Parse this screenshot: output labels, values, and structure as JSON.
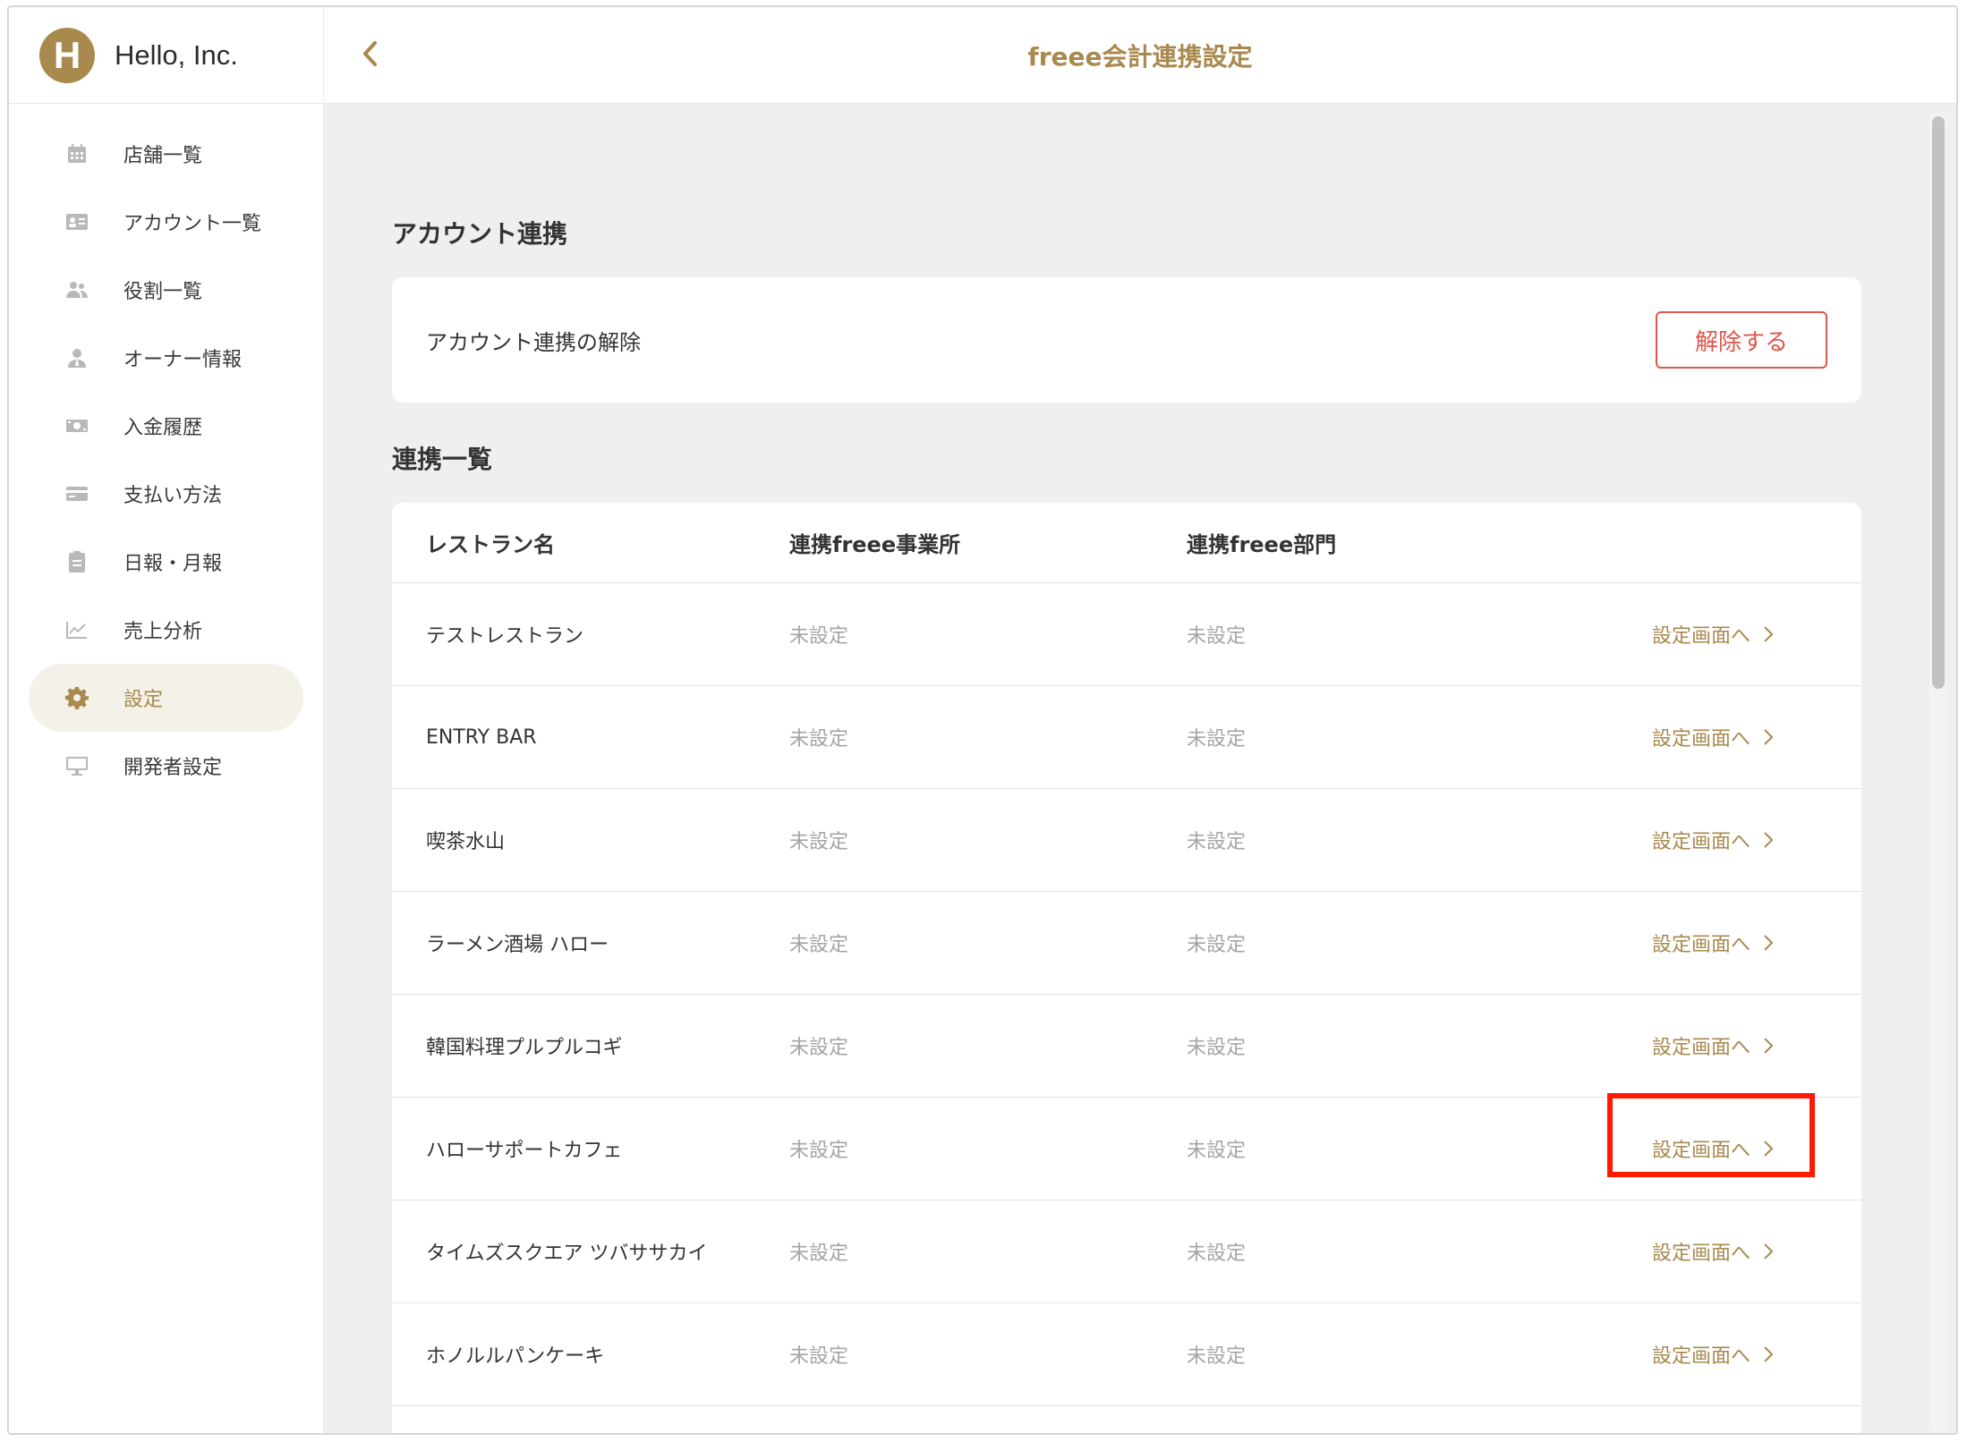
{
  "sidebar": {
    "brand_initial": "H",
    "brand_name": "Hello, Inc.",
    "items": [
      {
        "label": "店舗一覧",
        "icon": "calendar-icon",
        "active": false
      },
      {
        "label": "アカウント一覧",
        "icon": "id-card-icon",
        "active": false
      },
      {
        "label": "役割一覧",
        "icon": "users-icon",
        "active": false
      },
      {
        "label": "オーナー情報",
        "icon": "owner-icon",
        "active": false
      },
      {
        "label": "入金履歴",
        "icon": "money-icon",
        "active": false
      },
      {
        "label": "支払い方法",
        "icon": "credit-card-icon",
        "active": false
      },
      {
        "label": "日報・月報",
        "icon": "clipboard-icon",
        "active": false
      },
      {
        "label": "売上分析",
        "icon": "line-chart-icon",
        "active": false
      },
      {
        "label": "設定",
        "icon": "gear-icon",
        "active": true
      },
      {
        "label": "開発者設定",
        "icon": "monitor-icon",
        "active": false
      }
    ]
  },
  "header": {
    "title": "freee会計連携設定",
    "back_icon": "chevron-left-icon"
  },
  "account_section": {
    "title": "アカウント連携",
    "unlink_label": "アカウント連携の解除",
    "unlink_button": "解除する"
  },
  "list_section": {
    "title": "連携一覧",
    "columns": [
      "レストラン名",
      "連携freee事業所",
      "連携freee部門"
    ],
    "link_label": "設定画面へ",
    "rows": [
      {
        "name": "テストレストラン",
        "office": "未設定",
        "department": "未設定"
      },
      {
        "name": "ENTRY BAR",
        "office": "未設定",
        "department": "未設定"
      },
      {
        "name": "喫茶水山",
        "office": "未設定",
        "department": "未設定"
      },
      {
        "name": "ラーメン酒場 ハロー",
        "office": "未設定",
        "department": "未設定"
      },
      {
        "name": "韓国料理プルプルコギ",
        "office": "未設定",
        "department": "未設定"
      },
      {
        "name": "ハローサポートカフェ",
        "office": "未設定",
        "department": "未設定"
      },
      {
        "name": "タイムズスクエア ツバササカイ",
        "office": "未設定",
        "department": "未設定"
      },
      {
        "name": "ホノルルパンケーキ",
        "office": "未設定",
        "department": "未設定"
      }
    ],
    "highlighted_row": 5
  },
  "colors": {
    "accent": "#a8894e",
    "danger": "#e0564a",
    "highlight": "#ff1a00"
  }
}
